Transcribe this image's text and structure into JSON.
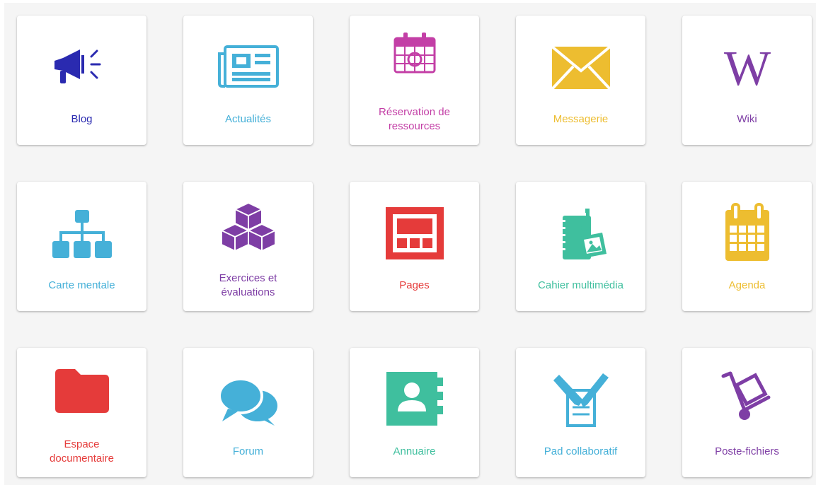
{
  "apps": [
    {
      "label": "Blog",
      "icon": "megaphone-icon",
      "color": "#2a2ab0"
    },
    {
      "label": "Actualités",
      "icon": "newspaper-icon",
      "color": "#45b0d8"
    },
    {
      "label": "Réservation de\nressources",
      "icon": "calendar-booking-icon",
      "color": "#c33fa6"
    },
    {
      "label": "Messagerie",
      "icon": "envelope-icon",
      "color": "#edbd30"
    },
    {
      "label": "Wiki",
      "icon": "wikipedia-w-icon",
      "color": "#7e3ea5"
    },
    {
      "label": "Carte mentale",
      "icon": "org-chart-icon",
      "color": "#45b0d8"
    },
    {
      "label": "Exercices et\névaluations",
      "icon": "cubes-icon",
      "color": "#7e3ea5"
    },
    {
      "label": "Pages",
      "icon": "page-layout-icon",
      "color": "#e53b3a"
    },
    {
      "label": "Cahier multimédia",
      "icon": "multimedia-notebook-icon",
      "color": "#3fbf9e"
    },
    {
      "label": "Agenda",
      "icon": "calendar-icon",
      "color": "#edbd30"
    },
    {
      "label": "Espace\ndocumentaire",
      "icon": "folder-icon",
      "color": "#e53b3a"
    },
    {
      "label": "Forum",
      "icon": "chat-bubbles-icon",
      "color": "#45b0d8"
    },
    {
      "label": "Annuaire",
      "icon": "address-book-icon",
      "color": "#3fbf9e"
    },
    {
      "label": "Pad collaboratif",
      "icon": "collaborative-pad-icon",
      "color": "#45b0d8"
    },
    {
      "label": "Poste-fichiers",
      "icon": "hand-truck-icon",
      "color": "#7e3ea5"
    }
  ]
}
